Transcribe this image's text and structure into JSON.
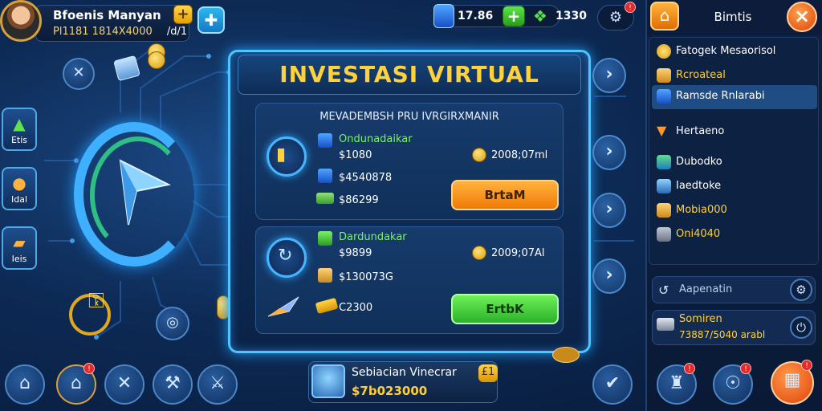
{
  "player": {
    "name": "Bfoenis Manyan",
    "id_text": "Pl1181 1814X4000",
    "id_suffix": "/d/1"
  },
  "top_bar": {
    "gems": "17.86",
    "cash": "1330"
  },
  "left_buttons": [
    {
      "label": "Etis"
    },
    {
      "label": "Idal"
    },
    {
      "label": "Ieis"
    }
  ],
  "panel": {
    "title": "INVESTASI VIRTUAL",
    "subtitle": "MEVADEMBSH PRU IVRGIRXMANIR",
    "cards": [
      {
        "category": "Ondunadaikar",
        "rows": [
          "$1080",
          "$4540878",
          "$86299"
        ],
        "coin_value": "2008;07ml",
        "button": "BrtaM"
      },
      {
        "category": "Dardundakar",
        "rows": [
          "$9899",
          "$130073G",
          "C2300"
        ],
        "coin_value": "2009;07Al",
        "button": "ErtbK"
      }
    ]
  },
  "sidebar": {
    "title": "Bimtis",
    "items": [
      {
        "label": "Fatogek Mesaorisol"
      },
      {
        "label": "Rcroateal"
      },
      {
        "label": "Ramsde Rnlarabi"
      },
      {
        "label": "Hertaeno"
      },
      {
        "label": "Dubodko"
      },
      {
        "label": "Iaedtoke"
      },
      {
        "label": "Mobia000"
      },
      {
        "label": "Oni4040"
      }
    ],
    "aapenatin_label": "Aapenatin",
    "summary": {
      "title": "Somiren",
      "value": "73887/5040 arabl"
    }
  },
  "bottom_profile": {
    "name": "Sebiacian Vinecrar",
    "money": "$7b023000",
    "badge": "£1"
  },
  "colors": {
    "title_gold": "#ffd23c",
    "panel_border": "#4fc4ff",
    "buy_orange": "#f07a06",
    "buy_green": "#2bb22a",
    "coin_gold": "#ffcf3a"
  }
}
